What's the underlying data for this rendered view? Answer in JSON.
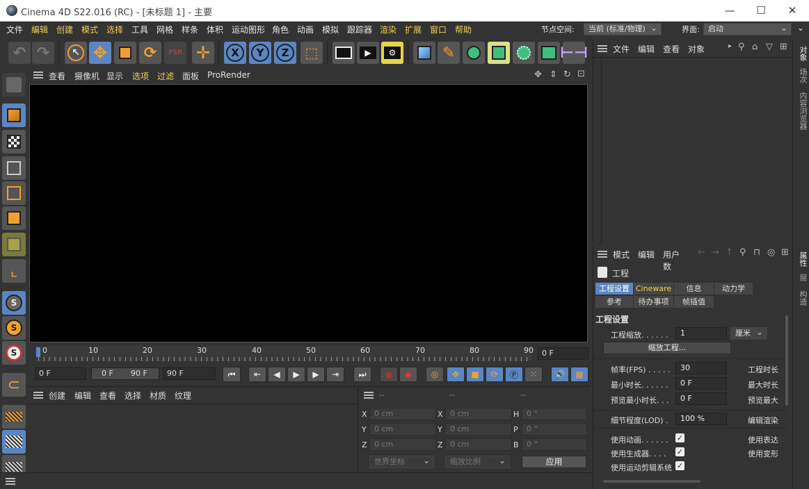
{
  "window": {
    "title": "Cinema 4D S22.016 (RC) - [未标题 1] - 主要",
    "minimize": "—",
    "maximize": "☐",
    "close": "✕"
  },
  "menubar": {
    "items": [
      "文件",
      "编辑",
      "创建",
      "模式",
      "选择",
      "工具",
      "网格",
      "样条",
      "体积",
      "运动图形",
      "角色",
      "动画",
      "模拟",
      "跟踪器",
      "渲染",
      "扩展",
      "窗口",
      "帮助"
    ],
    "node_space_label": "节点空间:",
    "node_space_value": "当前 (标准/物理)",
    "layout_label": "界面:",
    "layout_value": "启动"
  },
  "viewport": {
    "menu": [
      "查看",
      "摄像机",
      "显示",
      "选项",
      "过滤",
      "面板",
      "ProRender"
    ]
  },
  "timeline": {
    "ticks": [
      "0",
      "10",
      "20",
      "30",
      "40",
      "50",
      "60",
      "70",
      "80",
      "90"
    ],
    "end_frame_field": "0 F",
    "start_field": "0 F",
    "range_start": "0 F",
    "range_end": "90 F",
    "end_field": "90 F"
  },
  "material_panel": {
    "menu": [
      "创建",
      "编辑",
      "查看",
      "选择",
      "材质",
      "纹理"
    ]
  },
  "coord_panel": {
    "headers": [
      "--",
      "--",
      "--"
    ],
    "rows": [
      {
        "a_label": "X",
        "a_val": "0 cm",
        "b_label": "X",
        "b_val": "0 cm",
        "c_label": "H",
        "c_val": "0 °"
      },
      {
        "a_label": "Y",
        "a_val": "0 cm",
        "b_label": "Y",
        "b_val": "0 cm",
        "c_label": "P",
        "c_val": "0 °"
      },
      {
        "a_label": "Z",
        "a_val": "0 cm",
        "b_label": "Z",
        "b_val": "0 cm",
        "c_label": "B",
        "c_val": "0 °"
      }
    ],
    "world_coord": "世界坐标",
    "scale": "缩放比例",
    "apply": "应用"
  },
  "object_panel": {
    "menu": [
      "文件",
      "编辑",
      "查看",
      "对象"
    ]
  },
  "attr_panel": {
    "menu": [
      "模式",
      "编辑",
      "用户数"
    ],
    "project_label": "工程",
    "tabs_row1": [
      "工程设置",
      "Cineware",
      "信息",
      "动力学"
    ],
    "tabs_row2": [
      "参考",
      "待办事项",
      "帧插值"
    ],
    "section": "工程设置",
    "scale_label": "工程缩放. . . . . .",
    "scale_value": "1",
    "scale_unit": "厘米",
    "scale_button": "缩放工程...",
    "fps_label": "帧率(FPS) . . . . .",
    "fps_value": "30",
    "project_len_label": "工程时长",
    "min_len_label": "最小时长. . . . . .",
    "min_len_value": "0 F",
    "max_len_label": "最大时长",
    "prev_min_label": "预览最小时长. . .",
    "prev_min_value": "0 F",
    "prev_max_label": "预览最大",
    "lod_label": "细节程度(LOD) .",
    "lod_value": "100 %",
    "render_lod_label": "编辑渲染",
    "use_anim_label": "使用动画. . . . . .",
    "use_expr_label": "使用表达",
    "use_gen_label": "使用生成器. . . .",
    "use_deform_label": "使用变形",
    "use_motion_label": "使用运动剪辑系统"
  },
  "right_tabs": [
    "对象",
    "场次",
    "内容浏览器",
    "属性",
    "层",
    "构造"
  ]
}
